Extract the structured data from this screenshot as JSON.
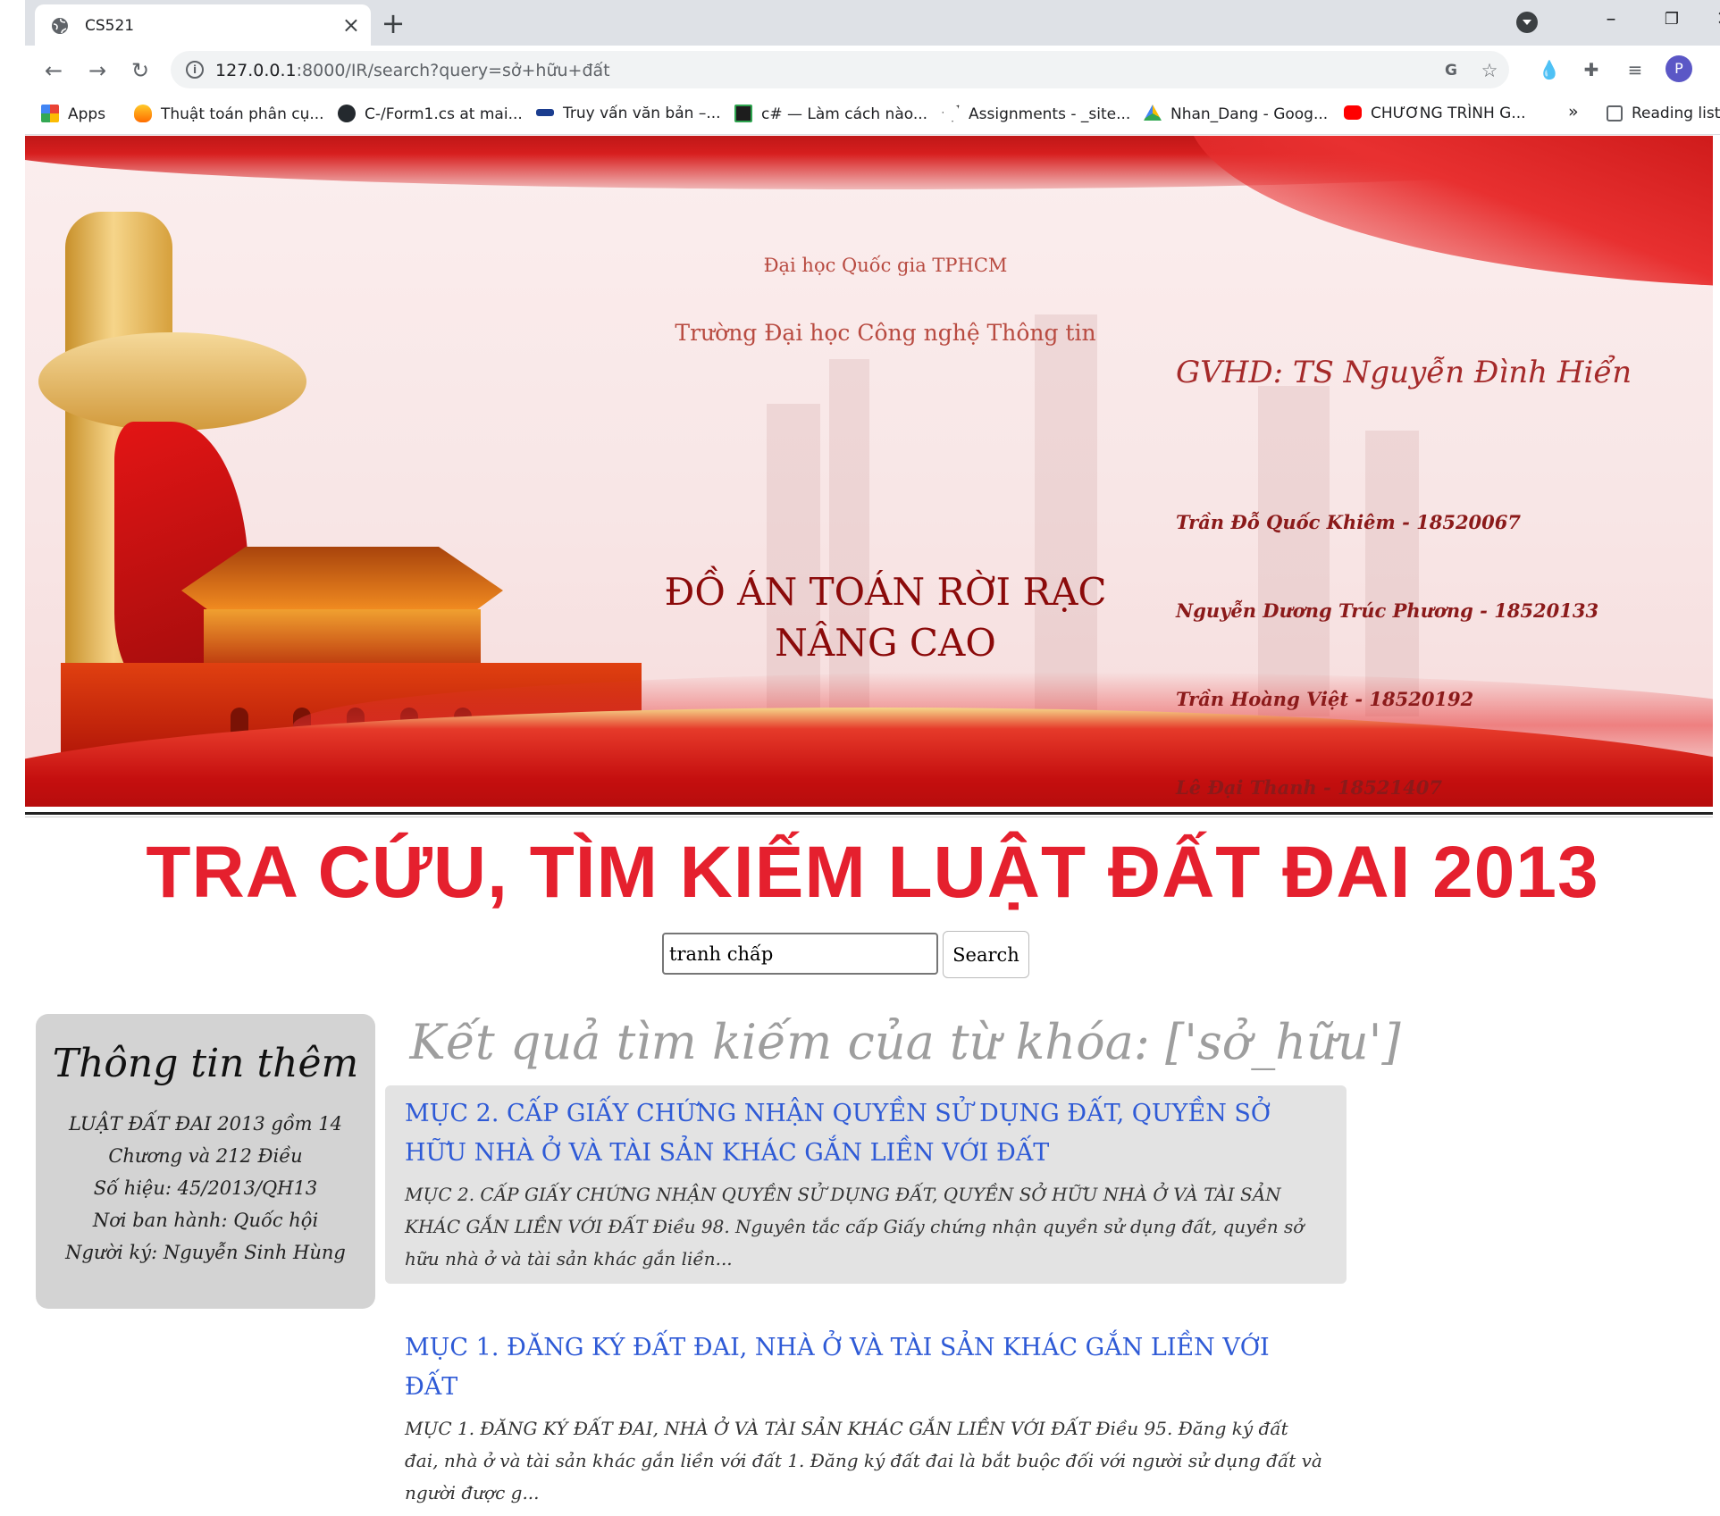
{
  "browser": {
    "tab_title": "CS521",
    "url_host": "127.0.0.1",
    "url_rest": ":8000/IR/search?query=sở+hữu+đất",
    "bookmarks": [
      {
        "label": "Apps",
        "icon": "apps-grid-icon"
      },
      {
        "label": "Thuật toán phân cụ...",
        "icon": "fire-icon"
      },
      {
        "label": "C-/Form1.cs at mai...",
        "icon": "github-icon"
      },
      {
        "label": "Truy vấn văn bản –...",
        "icon": "key-icon"
      },
      {
        "label": "c# — Làm cách nào...",
        "icon": "code-icon"
      },
      {
        "label": "Assignments - _site...",
        "icon": "send-icon"
      },
      {
        "label": "Nhan_Dang - Goog...",
        "icon": "drive-icon"
      },
      {
        "label": "CHƯƠNG TRÌNH G...",
        "icon": "youtube-icon"
      }
    ],
    "bookmarks_more": "»",
    "reading_list": "Reading list",
    "avatar_letter": "P"
  },
  "banner": {
    "university": "Đại học Quốc gia TPHCM",
    "school": "Trường Đại học Công nghệ Thông tin",
    "project_title": "ĐỒ ÁN TOÁN RỜI RẠC NÂNG CAO",
    "advisor": "GVHD: TS Nguyễn Đình Hiển",
    "members": [
      "Trần Đỗ Quốc Khiêm - 18520067",
      "Nguyễn Dương Trúc Phương - 18520133",
      "Trần Hoàng Việt - 18520192",
      "Lê Đại Thanh - 18521407"
    ]
  },
  "main_title": "TRA CỨU, TÌM KIẾM LUẬT ĐẤT ĐAI 2013",
  "search": {
    "value": "tranh chấp",
    "button_label": "Search"
  },
  "sidebar": {
    "title": "Thông tin thêm",
    "lines": [
      "LUẬT ĐẤT ĐAI 2013 gồm 14",
      "Chương và 212 Điều",
      "Số hiệu: 45/2013/QH13",
      "Nơi ban hành: Quốc hội",
      "Người ký: Nguyễn Sinh Hùng"
    ]
  },
  "results_heading": "Kết quả tìm kiếm của từ khóa: ['sở_hữu']",
  "results": [
    {
      "title": "MỤC 2. CẤP GIẤY CHỨNG NHẬN QUYỀN SỬ DỤNG ĐẤT, QUYỀN SỞ HỮU NHÀ Ở VÀ TÀI SẢN KHÁC GẮN LIỀN VỚI ĐẤT",
      "snippet": "MỤC 2. CẤP GIẤY CHỨNG NHẬN QUYỀN SỬ DỤNG ĐẤT, QUYỀN SỞ HỮU NHÀ Ở VÀ TÀI SẢN KHÁC GẮN LIỀN VỚI ĐẤT Điều 98. Nguyên tắc cấp Giấy chứng nhận quyền sử dụng đất, quyền sở hữu nhà ở và tài sản khác gắn liền..."
    },
    {
      "title": "MỤC 1. ĐĂNG KÝ ĐẤT ĐAI, NHÀ Ở VÀ TÀI SẢN KHÁC GẮN LIỀN VỚI ĐẤT",
      "snippet": "MỤC 1. ĐĂNG KÝ ĐẤT ĐAI, NHÀ Ở VÀ TÀI SẢN KHÁC GẮN LIỀN VỚI ĐẤT Điều 95. Đăng ký đất đai, nhà ở và tài sản khác gắn liền với đất 1. Đăng ký đất đai là bắt buộc đối với người sử dụng đất và người được g..."
    }
  ]
}
